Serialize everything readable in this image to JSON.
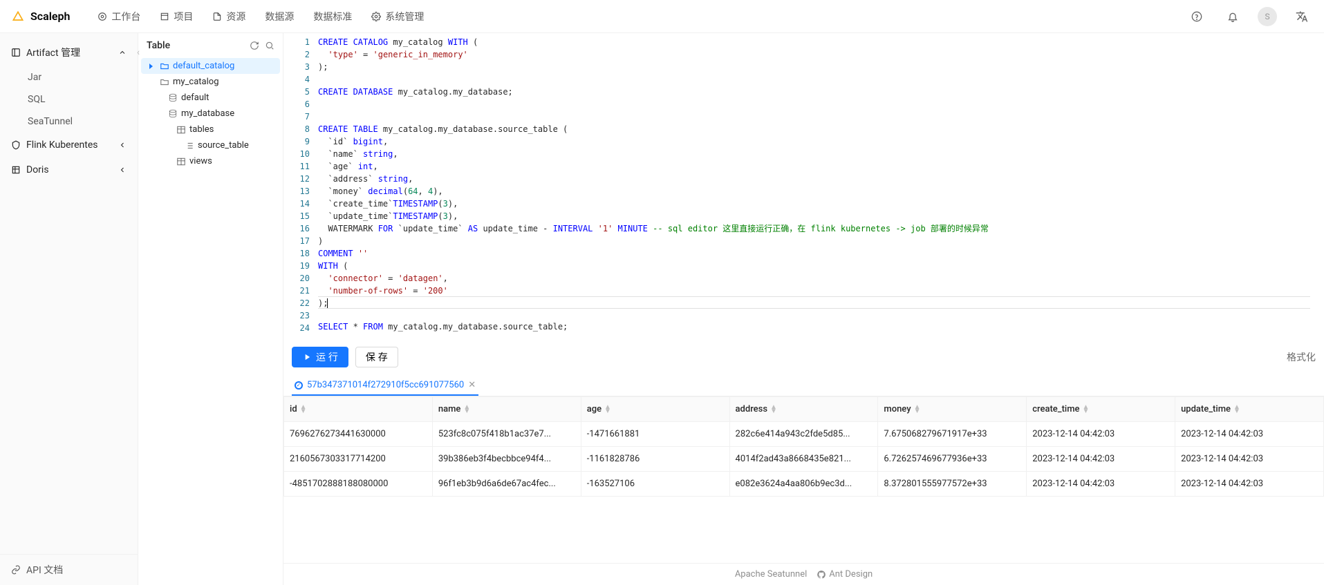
{
  "brand": "Scaleph",
  "nav": [
    {
      "label": "工作台"
    },
    {
      "label": "项目"
    },
    {
      "label": "资源"
    },
    {
      "label": "数据源"
    },
    {
      "label": "数据标准"
    },
    {
      "label": "系统管理"
    }
  ],
  "avatar_initial": "S",
  "sidebar": {
    "groups": [
      {
        "title": "Artifact 管理",
        "expanded": true,
        "items": [
          "Jar",
          "SQL",
          "SeaTunnel"
        ]
      },
      {
        "title": "Flink Kuberentes",
        "expanded": false,
        "items": []
      },
      {
        "title": "Doris",
        "expanded": false,
        "items": []
      }
    ],
    "api_link": "API 文档"
  },
  "tree": {
    "title": "Table",
    "nodes": {
      "default_catalog": "default_catalog",
      "my_catalog": "my_catalog",
      "default": "default",
      "my_database": "my_database",
      "tables": "tables",
      "source_table": "source_table",
      "views": "views"
    }
  },
  "code": [
    [
      {
        "t": "CREATE CATALOG",
        "c": "kw"
      },
      {
        "t": " my_catalog "
      },
      {
        "t": "WITH",
        "c": "kw"
      },
      {
        "t": " ("
      }
    ],
    [
      {
        "t": "  "
      },
      {
        "t": "'type'",
        "c": "str"
      },
      {
        "t": " = "
      },
      {
        "t": "'generic_in_memory'",
        "c": "str"
      }
    ],
    [
      {
        "t": ");"
      }
    ],
    [],
    [
      {
        "t": "CREATE DATABASE",
        "c": "kw"
      },
      {
        "t": " my_catalog.my_database;"
      }
    ],
    [],
    [],
    [
      {
        "t": "CREATE TABLE",
        "c": "kw"
      },
      {
        "t": " my_catalog.my_database.source_table ("
      }
    ],
    [
      {
        "t": "  `id` "
      },
      {
        "t": "bigint",
        "c": "kw"
      },
      {
        "t": ","
      }
    ],
    [
      {
        "t": "  `name` "
      },
      {
        "t": "string",
        "c": "kw"
      },
      {
        "t": ","
      }
    ],
    [
      {
        "t": "  `age` "
      },
      {
        "t": "int",
        "c": "kw"
      },
      {
        "t": ","
      }
    ],
    [
      {
        "t": "  `address` "
      },
      {
        "t": "string",
        "c": "kw"
      },
      {
        "t": ","
      }
    ],
    [
      {
        "t": "  `money` "
      },
      {
        "t": "decimal",
        "c": "kw"
      },
      {
        "t": "("
      },
      {
        "t": "64",
        "c": "num"
      },
      {
        "t": ", "
      },
      {
        "t": "4",
        "c": "num"
      },
      {
        "t": "),"
      }
    ],
    [
      {
        "t": "  `create_time`"
      },
      {
        "t": "TIMESTAMP",
        "c": "kw"
      },
      {
        "t": "("
      },
      {
        "t": "3",
        "c": "num"
      },
      {
        "t": "),"
      }
    ],
    [
      {
        "t": "  `update_time`"
      },
      {
        "t": "TIMESTAMP",
        "c": "kw"
      },
      {
        "t": "("
      },
      {
        "t": "3",
        "c": "num"
      },
      {
        "t": "),"
      }
    ],
    [
      {
        "t": "  WATERMARK "
      },
      {
        "t": "FOR",
        "c": "kw"
      },
      {
        "t": " `update_time` "
      },
      {
        "t": "AS",
        "c": "kw"
      },
      {
        "t": " update_time - "
      },
      {
        "t": "INTERVAL",
        "c": "kw"
      },
      {
        "t": " "
      },
      {
        "t": "'1'",
        "c": "str"
      },
      {
        "t": " "
      },
      {
        "t": "MINUTE",
        "c": "kw"
      },
      {
        "t": " "
      },
      {
        "t": "-- sql editor 这里直接运行正确，在 flink kubernetes -> job 部署的时候异常",
        "c": "cmt"
      }
    ],
    [
      {
        "t": ")"
      }
    ],
    [
      {
        "t": "COMMENT",
        "c": "kw"
      },
      {
        "t": " "
      },
      {
        "t": "''",
        "c": "str"
      }
    ],
    [
      {
        "t": "WITH",
        "c": "kw"
      },
      {
        "t": " ("
      }
    ],
    [
      {
        "t": "  "
      },
      {
        "t": "'connector'",
        "c": "str"
      },
      {
        "t": " = "
      },
      {
        "t": "'datagen'",
        "c": "str"
      },
      {
        "t": ","
      }
    ],
    [
      {
        "t": "  "
      },
      {
        "t": "'number-of-rows'",
        "c": "str"
      },
      {
        "t": " = "
      },
      {
        "t": "'200'",
        "c": "str"
      }
    ],
    [
      {
        "t": ");"
      }
    ],
    [],
    [
      {
        "t": "SELECT",
        "c": "kw"
      },
      {
        "t": " * "
      },
      {
        "t": "FROM",
        "c": "kw"
      },
      {
        "t": " my_catalog.my_database.source_table;"
      }
    ]
  ],
  "cursor_line": 22,
  "toolbar": {
    "run": "运 行",
    "save": "保 存",
    "format": "格式化"
  },
  "result_tab": "57b347371014f272910f5cc691077560",
  "table": {
    "columns": [
      "id",
      "name",
      "age",
      "address",
      "money",
      "create_time",
      "update_time"
    ],
    "rows": [
      [
        "7696276273441630000",
        "523fc8c075f418b1ac37e7...",
        "-1471661881",
        "282c6e414a943c2fde5d85...",
        "7.675068279671917e+33",
        "2023-12-14 04:42:03",
        "2023-12-14 04:42:03"
      ],
      [
        "2160567303317714200",
        "39b386eb3f4becbbce94f4...",
        "-1161828786",
        "4014f2ad43a8668435e821...",
        "6.726257469677936e+33",
        "2023-12-14 04:42:03",
        "2023-12-14 04:42:03"
      ],
      [
        "-4851702888188080000",
        "96f1eb3b9d6a6de67ac4fec...",
        "-163527106",
        "e082e3624a4aa806b9ec3d...",
        "8.372801555977572e+33",
        "2023-12-14 04:42:03",
        "2023-12-14 04:42:03"
      ]
    ]
  },
  "footer": {
    "seatunnel": "Apache Seatunnel",
    "antd": "Ant Design"
  }
}
